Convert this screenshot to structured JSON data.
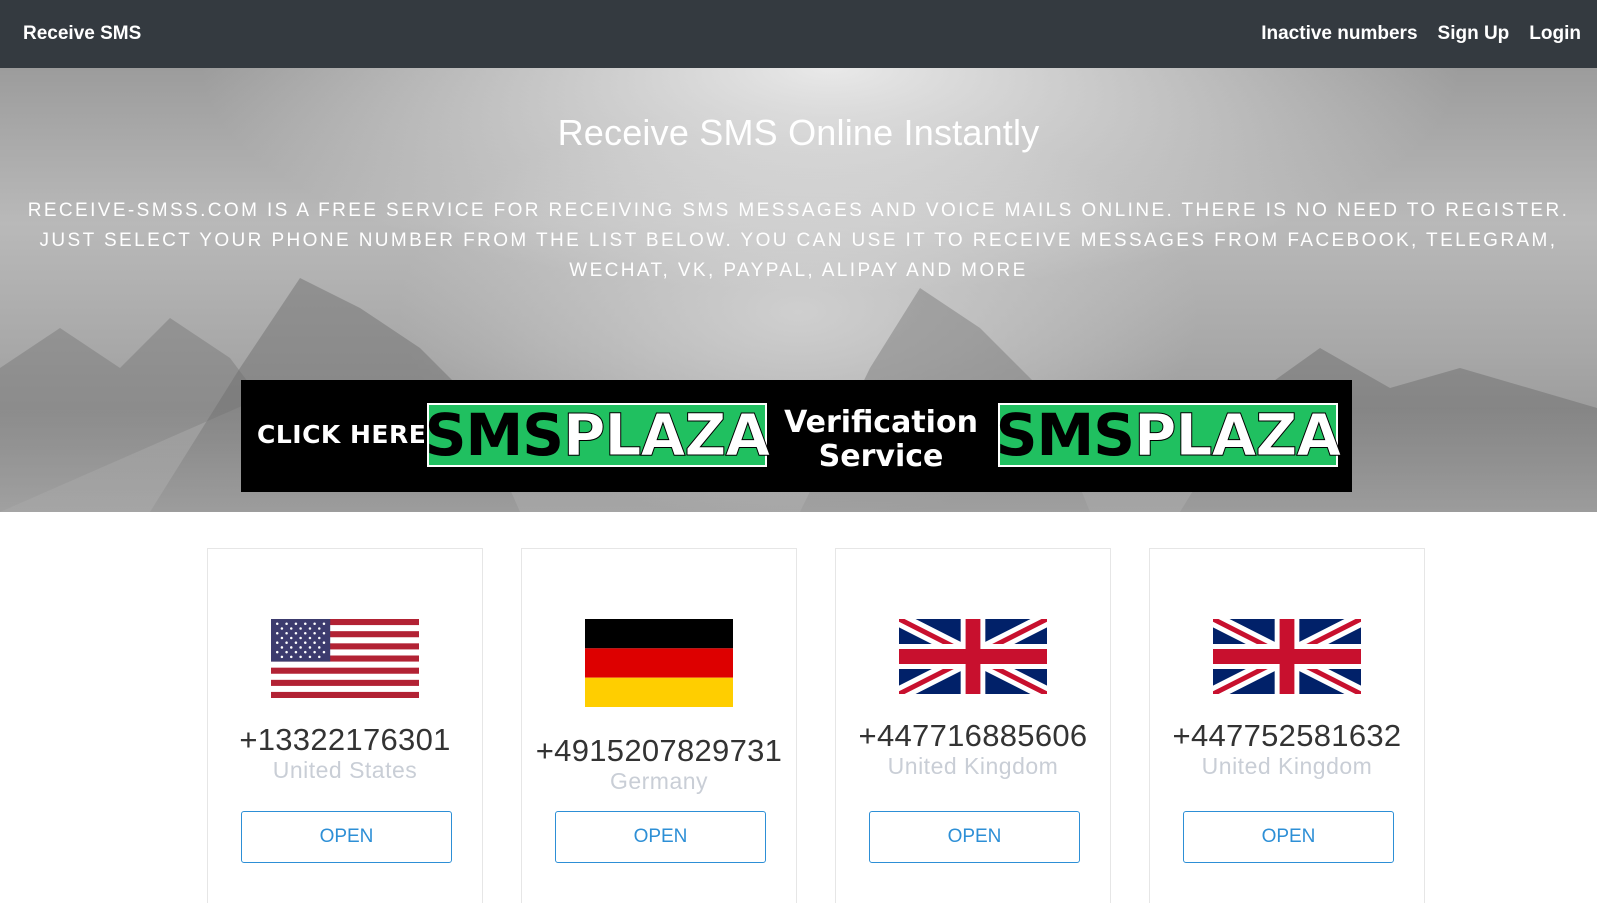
{
  "navbar": {
    "brand": "Receive SMS",
    "links": [
      {
        "label": "Inactive numbers"
      },
      {
        "label": "Sign Up"
      },
      {
        "label": "Login"
      }
    ]
  },
  "hero": {
    "title": "Receive SMS Online Instantly",
    "description": "RECEIVE-SMSS.COM IS A FREE SERVICE FOR RECEIVING SMS MESSAGES AND VOICE MAILS ONLINE. THERE IS NO NEED TO REGISTER. JUST SELECT YOUR PHONE NUMBER FROM THE LIST BELOW. YOU CAN USE IT TO RECEIVE MESSAGES FROM FACEBOOK, TELEGRAM, WECHAT, VK, PAYPAL, ALIPAY AND MORE"
  },
  "banner": {
    "cta": "CLICK HERE",
    "logo_part1": "SMS",
    "logo_part2": "PLAZA",
    "middle_line1": "Verification",
    "middle_line2": "Service",
    "accent_color": "#20c060"
  },
  "numbers": [
    {
      "number": "+13322176301",
      "country": "United States",
      "flag": "us-flag-icon",
      "button": "OPEN"
    },
    {
      "number": "+4915207829731",
      "country": "Germany",
      "flag": "de-flag-icon",
      "button": "OPEN"
    },
    {
      "number": "+447716885606",
      "country": "United Kingdom",
      "flag": "gb-flag-icon",
      "button": "OPEN"
    },
    {
      "number": "+447752581632",
      "country": "United Kingdom",
      "flag": "gb-flag-icon",
      "button": "OPEN"
    }
  ],
  "colors": {
    "navbar_bg": "#343a40",
    "button_accent": "#2d8fd6",
    "country_text": "#c9ced6"
  }
}
